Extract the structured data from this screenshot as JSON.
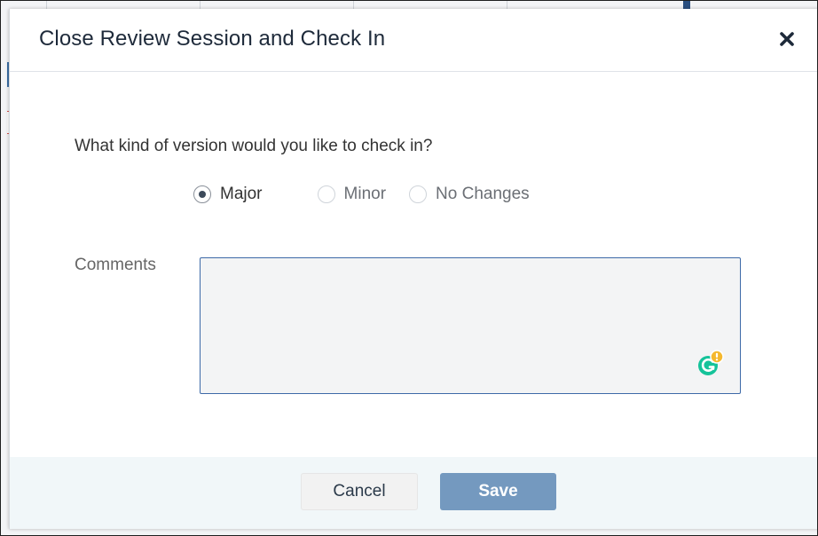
{
  "dialog": {
    "title": "Close Review Session and Check In",
    "question": "What kind of version would you like to check in?",
    "options": [
      {
        "label": "Major",
        "checked": true,
        "enabled": true
      },
      {
        "label": "Minor",
        "checked": false,
        "enabled": false
      },
      {
        "label": "No Changes",
        "checked": false,
        "enabled": true
      }
    ],
    "comments_label": "Comments",
    "comments_value": "",
    "cancel_label": "Cancel",
    "save_label": "Save",
    "close_icon": "close-icon"
  },
  "colors": {
    "title": "#1e2a3a",
    "input_border": "#3d6aa8",
    "save_button": "#7499bf",
    "footer_bg": "#f1f7f9",
    "grammarly_green": "#15c39a",
    "grammarly_badge": "#f5b82e"
  }
}
